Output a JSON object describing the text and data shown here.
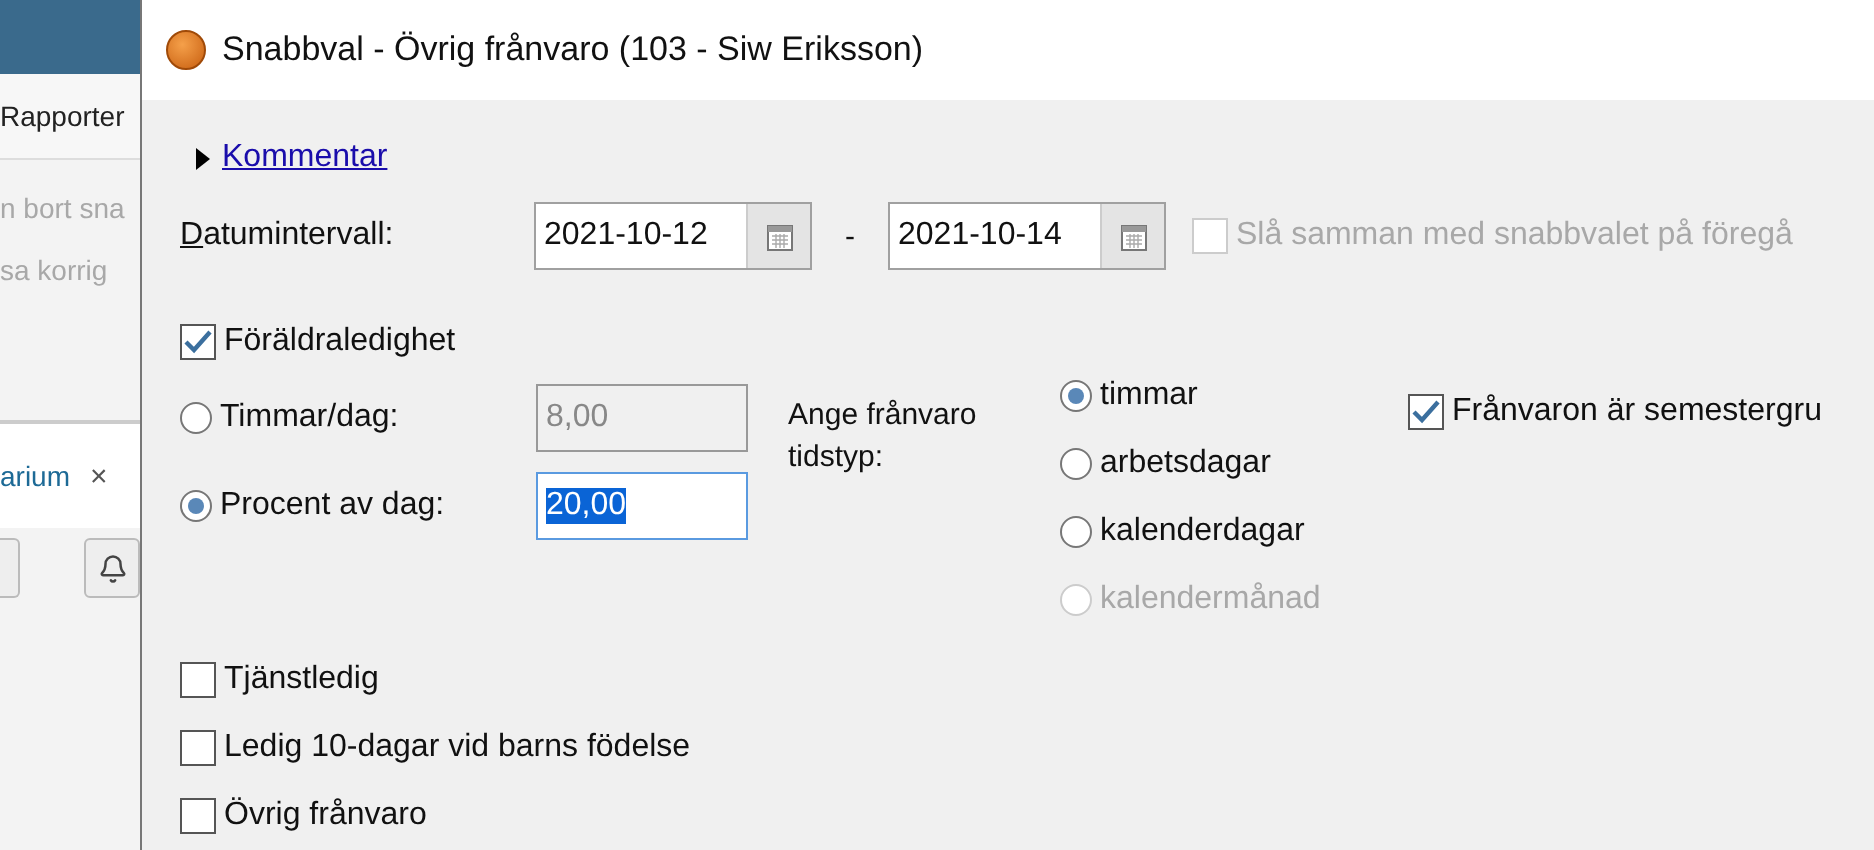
{
  "background_app": {
    "menu_item": "Rapporter",
    "lines": [
      "n bort sna",
      "sa korrig"
    ],
    "tab": {
      "label": "arium",
      "close": "×"
    }
  },
  "dialog": {
    "title": "Snabbval - Övrig frånvaro (103 - Siw Eriksson)",
    "comment_link": "Kommentar",
    "date_label": "Datumintervall:",
    "date_from": "2021-10-12",
    "date_separator": "-",
    "date_to": "2021-10-14",
    "merge": {
      "label": "Slå samman med snabbvalet på föregå",
      "checked": false,
      "disabled": true
    },
    "parental_leave": {
      "label": "Föräldraledighet",
      "checked": true
    },
    "amount_options": [
      {
        "label": "Timmar/dag:",
        "selected": false,
        "value": "8,00"
      },
      {
        "label": "Procent av dag:",
        "selected": true,
        "value": "20,00"
      }
    ],
    "absence_type": {
      "label": "Ange frånvaro tidstyp:",
      "options": [
        {
          "label": "timmar",
          "selected": true,
          "disabled": false
        },
        {
          "label": "arbetsdagar",
          "selected": false,
          "disabled": false
        },
        {
          "label": "kalenderdagar",
          "selected": false,
          "disabled": false
        },
        {
          "label": "kalendermånad",
          "selected": false,
          "disabled": true
        }
      ]
    },
    "vacation": {
      "label": "Frånvaron är semestergru",
      "checked": true
    },
    "other_checkboxes": [
      {
        "label": "Tjänstledig",
        "checked": false
      },
      {
        "label": "Ledig 10-dagar vid barns födelse",
        "checked": false
      },
      {
        "label": "Övrig frånvaro",
        "checked": false
      }
    ]
  }
}
